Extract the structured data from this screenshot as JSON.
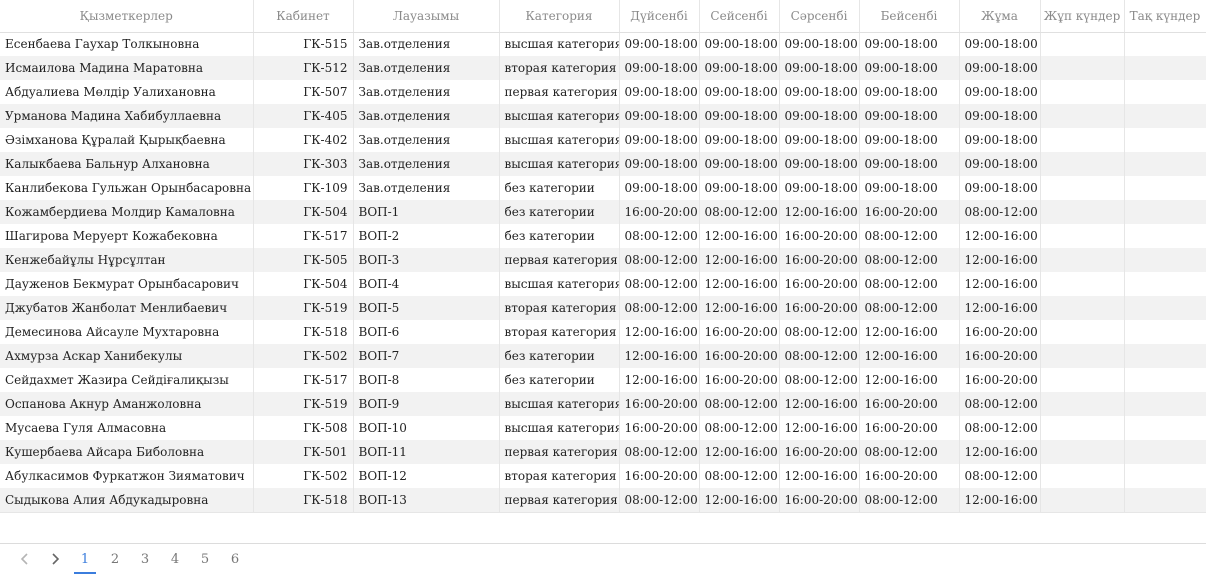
{
  "table": {
    "headers": [
      "Қызметкерлер",
      "Кабинет",
      "Лауазымы",
      "Категория",
      "Дүйсенбі",
      "Сейсенбі",
      "Сәрсенбі",
      "Бейсенбі",
      "Жұма",
      "Жұп күндер",
      "Тақ күндер"
    ],
    "rows": [
      [
        "Есенбаева Гаухар Толкыновна",
        "ГК-515",
        "Зав.отделения",
        "высшая категория",
        "09:00-18:00",
        "09:00-18:00",
        "09:00-18:00",
        "09:00-18:00",
        "09:00-18:00",
        "",
        ""
      ],
      [
        "Исмаилова Мадина Маратовна",
        "ГК-512",
        "Зав.отделения",
        "вторая категория",
        "09:00-18:00",
        "09:00-18:00",
        "09:00-18:00",
        "09:00-18:00",
        "09:00-18:00",
        "",
        ""
      ],
      [
        "Абдуалиева Мөлдір Уалихановна",
        "ГК-507",
        "Зав.отделения",
        "первая категория",
        "09:00-18:00",
        "09:00-18:00",
        "09:00-18:00",
        "09:00-18:00",
        "09:00-18:00",
        "",
        ""
      ],
      [
        "Урманова Мадина Хабибуллаевна",
        "ГК-405",
        "Зав.отделения",
        "высшая категория",
        "09:00-18:00",
        "09:00-18:00",
        "09:00-18:00",
        "09:00-18:00",
        "09:00-18:00",
        "",
        ""
      ],
      [
        "Әзімханова Құралай Қырықбаевна",
        "ГК-402",
        "Зав.отделения",
        "высшая категория",
        "09:00-18:00",
        "09:00-18:00",
        "09:00-18:00",
        "09:00-18:00",
        "09:00-18:00",
        "",
        ""
      ],
      [
        "Калыкбаева Бальнур Алхановна",
        "ГК-303",
        "Зав.отделения",
        "высшая категория",
        "09:00-18:00",
        "09:00-18:00",
        "09:00-18:00",
        "09:00-18:00",
        "09:00-18:00",
        "",
        ""
      ],
      [
        "Канлибекова Гульжан Орынбасаровна",
        "ГК-109",
        "Зав.отделения",
        "без категории",
        "09:00-18:00",
        "09:00-18:00",
        "09:00-18:00",
        "09:00-18:00",
        "09:00-18:00",
        "",
        ""
      ],
      [
        "Кожамбердиева Молдир Камаловна",
        "ГК-504",
        "ВОП-1",
        "без категории",
        "16:00-20:00",
        "08:00-12:00",
        "12:00-16:00",
        "16:00-20:00",
        "08:00-12:00",
        "",
        ""
      ],
      [
        "Шагирова Меруерт Кожабековна",
        "ГК-517",
        "ВОП-2",
        "без категории",
        "08:00-12:00",
        "12:00-16:00",
        "16:00-20:00",
        "08:00-12:00",
        "12:00-16:00",
        "",
        ""
      ],
      [
        "Кенжебайұлы Нұрсұлтан",
        "ГК-505",
        "ВОП-3",
        "первая категория",
        "08:00-12:00",
        "12:00-16:00",
        "16:00-20:00",
        "08:00-12:00",
        "12:00-16:00",
        "",
        ""
      ],
      [
        "Дауженов Бекмурат Орынбасарович",
        "ГК-504",
        "ВОП-4",
        "высшая категория",
        "08:00-12:00",
        "12:00-16:00",
        "16:00-20:00",
        "08:00-12:00",
        "12:00-16:00",
        "",
        ""
      ],
      [
        "Джубатов Жанболат Менлибаевич",
        "ГК-519",
        "ВОП-5",
        "вторая категория",
        "08:00-12:00",
        "12:00-16:00",
        "16:00-20:00",
        "08:00-12:00",
        "12:00-16:00",
        "",
        ""
      ],
      [
        "Демесинова Айсауле Мухтаровна",
        "ГК-518",
        "ВОП-6",
        "вторая категория",
        "12:00-16:00",
        "16:00-20:00",
        "08:00-12:00",
        "12:00-16:00",
        "16:00-20:00",
        "",
        ""
      ],
      [
        "Ахмурза Аскар Ханибекулы",
        "ГК-502",
        "ВОП-7",
        "без категории",
        "12:00-16:00",
        "16:00-20:00",
        "08:00-12:00",
        "12:00-16:00",
        "16:00-20:00",
        "",
        ""
      ],
      [
        "Сейдахмет Жазира Сейдіғалиқызы",
        "ГК-517",
        "ВОП-8",
        "без категории",
        "12:00-16:00",
        "16:00-20:00",
        "08:00-12:00",
        "12:00-16:00",
        "16:00-20:00",
        "",
        ""
      ],
      [
        "Оспанова Акнур Аманжоловна",
        "ГК-519",
        "ВОП-9",
        "высшая категория",
        "16:00-20:00",
        "08:00-12:00",
        "12:00-16:00",
        "16:00-20:00",
        "08:00-12:00",
        "",
        ""
      ],
      [
        "Мусаева Гуля Алмасовна",
        "ГК-508",
        "ВОП-10",
        "высшая категория",
        "16:00-20:00",
        "08:00-12:00",
        "12:00-16:00",
        "16:00-20:00",
        "08:00-12:00",
        "",
        ""
      ],
      [
        "Кушербаева Айсара Биболовна",
        "ГК-501",
        "ВОП-11",
        "первая категория",
        "08:00-12:00",
        "12:00-16:00",
        "16:00-20:00",
        "08:00-12:00",
        "12:00-16:00",
        "",
        ""
      ],
      [
        "Абулкасимов Фуркатжон Зияматович",
        "ГК-502",
        "ВОП-12",
        "вторая категория",
        "16:00-20:00",
        "08:00-12:00",
        "12:00-16:00",
        "16:00-20:00",
        "08:00-12:00",
        "",
        ""
      ],
      [
        "Сыдыкова Алия Абдукадыровна",
        "ГК-518",
        "ВОП-13",
        "первая категория",
        "08:00-12:00",
        "12:00-16:00",
        "16:00-20:00",
        "08:00-12:00",
        "12:00-16:00",
        "",
        ""
      ]
    ]
  },
  "pagination": {
    "prev_icon": "chevron-left-icon",
    "next_icon": "chevron-right-icon",
    "pages": [
      "1",
      "2",
      "3",
      "4",
      "5",
      "6"
    ],
    "current": "1",
    "accent_color": "#3b7ddd"
  }
}
